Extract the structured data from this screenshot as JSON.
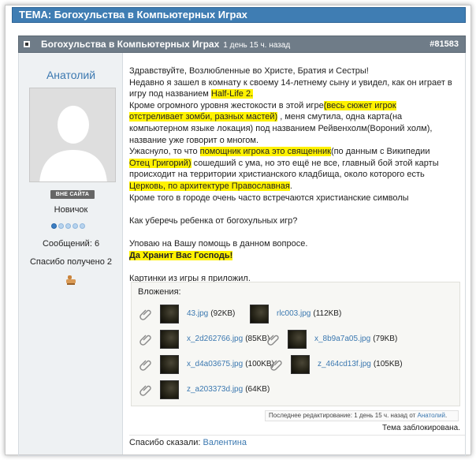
{
  "topic": {
    "title": "ТЕМА: Богохульства в Компьютерных Играх"
  },
  "post": {
    "title": "Богохульства в Компьютерных Играх",
    "time": "1 день 15 ч. назад",
    "number": "#81583"
  },
  "user": {
    "name": "Анатолий",
    "status": "ВНЕ САЙТА",
    "rank": "Новичок",
    "rank_dots_filled": 1,
    "rank_dots_total": 5,
    "messages": "Сообщений: 6",
    "thanks_received": "Спасибо получено 2"
  },
  "message": {
    "l1": "Здравствуйте, Возлюбленные во Христе, Братия и Сестры!",
    "l2": "Недавно я зашел в комнату к своему 14-летнему сыну и увидел, как он играет в",
    "l3a": "игру под названием ",
    "l3b": "Half-Life 2.",
    "l4a": "Кроме огромного уровня жестокости в этой игре",
    "l4b": "(весь сюжет игрок",
    "l5a": "отстреливает зомби, разных мастей)",
    "l5b": " , меня смутила, одна карта(на",
    "l6": "компьютерном языке локация) под названием Рейвенхолм(Вороний холм),",
    "l7": "название уже говорит о многом.",
    "l8a": "Ужаснуло, то что ",
    "l8b": "помощник игрока это священник",
    "l8c": "(по данным с Википедии",
    "l9a": "Отец Григорий)",
    "l9b": " сошедший с ума, но это ещё не все, главный бой этой карты",
    "l10": "происходит на территории христианского кладбища, около которого есть",
    "l11a": "Церковь, по архитектуре Православная",
    "l11b": ".",
    "l12": "Кроме того в городе очень часто встречаются христианские символы",
    "l13": "Как уберечь ребенка от богохульных игр?",
    "l14": "Уповаю на Вашу помощь в данном вопросе.",
    "l15": "Да Хранит Вас Господь!",
    "l16": "Картинки из игры я приложил."
  },
  "attachments": {
    "title": "Вложения:",
    "items": [
      {
        "name": "43.jpg",
        "size": "(92KB)"
      },
      {
        "name": "rlc003.jpg",
        "size": "(112KB)"
      },
      {
        "name": "x_2d262766.jpg",
        "size": "(85KB)"
      },
      {
        "name": "x_8b9a7a05.jpg",
        "size": "(79KB)"
      },
      {
        "name": "x_d4a03675.jpg",
        "size": "(100KB)"
      },
      {
        "name": "z_464cd13f.jpg",
        "size": "(105KB)"
      },
      {
        "name": "z_a203373d.jpg",
        "size": "(64KB)"
      }
    ]
  },
  "footer": {
    "edit_prefix": "Последнее редактирование: 1 день 15 ч. назад от",
    "edit_user": "Анатолий",
    "edit_suffix": ".",
    "locked": "Тема заблокирована.",
    "thanks_label": "Спасибо сказали:",
    "thanks_user": "Валентина"
  },
  "colors": {
    "topic_bar": "#3f7db3",
    "post_header": "#6f7c88",
    "link": "#3b78b0",
    "highlight": "#fff200"
  }
}
